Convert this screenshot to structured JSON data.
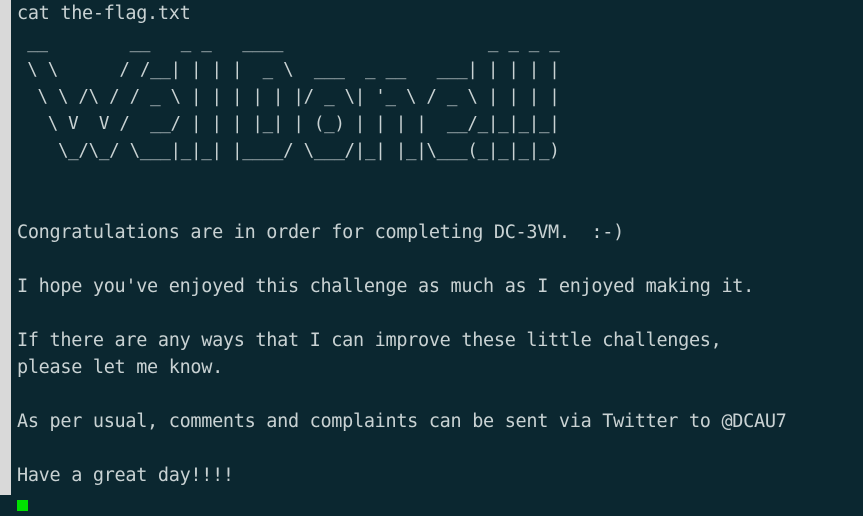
{
  "terminal": {
    "command": "cat the-flag.txt",
    "ascii_art": [
      " __        __   _ _   ____                    _ _ _ _ ",
      " \\ \\      / /__| | | |  _ \\  ___  _ __   ___| | | | |",
      "  \\ \\ /\\ / / _ \\ | | | | | |/ _ \\| '_ \\ / _ \\ | | | |",
      "   \\ V  V /  __/ | | | |_| | (_) | | | |  __/_|_|_|_|",
      "    \\_/\\_/ \\___|_|_| |____/ \\___/|_| |_|\\___(_|_|_|_)"
    ],
    "lines": [
      "Congratulations are in order for completing DC-3VM.  :-)",
      "I hope you've enjoyed this challenge as much as I enjoyed making it.",
      "If there are any ways that I can improve these little challenges,",
      "please let me know.",
      "As per usual, comments and complaints can be sent via Twitter to @DCAU7",
      "Have a great day!!!!"
    ],
    "colors": {
      "background": "#0b2730",
      "text": "#c9d2d3",
      "cursor": "#00e000",
      "strip": "#d9d9d9"
    }
  }
}
